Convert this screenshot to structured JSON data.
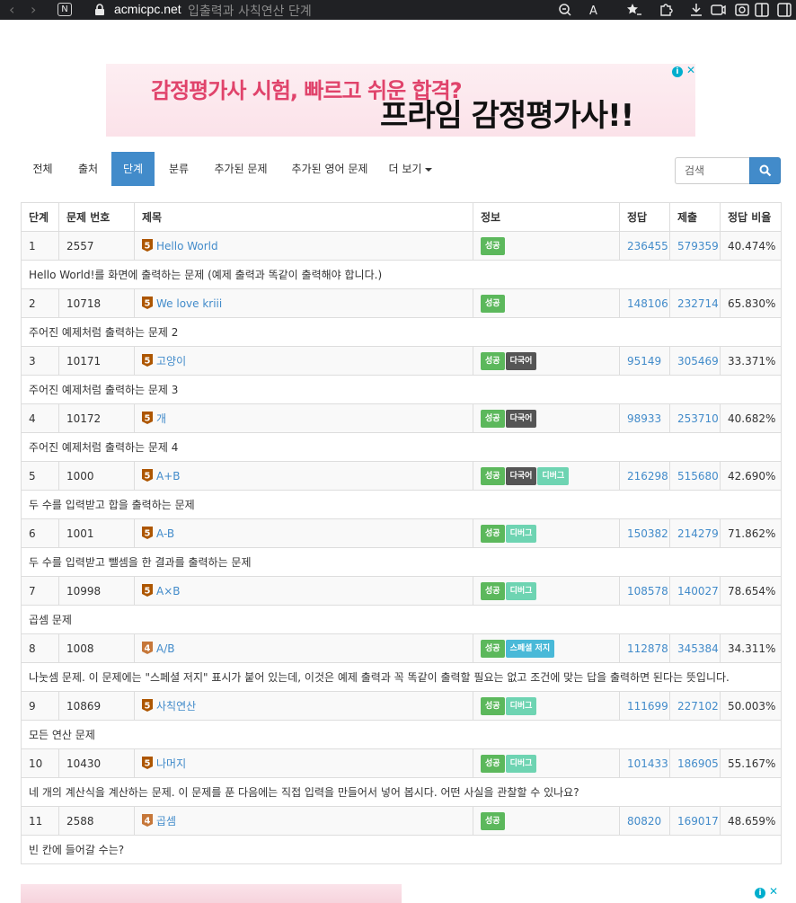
{
  "browser": {
    "url": "acmicpc.net",
    "page_title": "입출력과 사칙연산 단계"
  },
  "ad_top": {
    "line1": "감정평가사 시험, 빠르고 쉬운 합격?",
    "line2": "프라임 감정평가사!!"
  },
  "tabs": [
    {
      "label": "전체"
    },
    {
      "label": "출처"
    },
    {
      "label": "단계",
      "active": true
    },
    {
      "label": "분류"
    },
    {
      "label": "추가된 문제"
    },
    {
      "label": "추가된 영어 문제"
    },
    {
      "label": "더 보기"
    }
  ],
  "search": {
    "placeholder": "검색"
  },
  "table": {
    "headers": [
      "단계",
      "문제 번호",
      "제목",
      "정보",
      "정답",
      "제출",
      "정답 비율"
    ],
    "rows": [
      {
        "step": "1",
        "id": "2557",
        "tier": "5",
        "title": "Hello World",
        "labels": [
          "성공"
        ],
        "correct": "236455",
        "submit": "579359",
        "ratio": "40.474%",
        "desc": "Hello World!를 화면에 출력하는 문제 (예제 출력과 똑같이 출력해야 합니다.)"
      },
      {
        "step": "2",
        "id": "10718",
        "tier": "5",
        "title": "We love kriii",
        "labels": [
          "성공"
        ],
        "correct": "148106",
        "submit": "232714",
        "ratio": "65.830%",
        "desc": "주어진 예제처럼 출력하는 문제 2"
      },
      {
        "step": "3",
        "id": "10171",
        "tier": "5",
        "title": "고양이",
        "labels": [
          "성공",
          "다국어"
        ],
        "correct": "95149",
        "submit": "305469",
        "ratio": "33.371%",
        "desc": "주어진 예제처럼 출력하는 문제 3"
      },
      {
        "step": "4",
        "id": "10172",
        "tier": "5",
        "title": "개",
        "labels": [
          "성공",
          "다국어"
        ],
        "correct": "98933",
        "submit": "253710",
        "ratio": "40.682%",
        "desc": "주어진 예제처럼 출력하는 문제 4"
      },
      {
        "step": "5",
        "id": "1000",
        "tier": "5",
        "title": "A+B",
        "labels": [
          "성공",
          "다국어",
          "디버그"
        ],
        "correct": "216298",
        "submit": "515680",
        "ratio": "42.690%",
        "desc": "두 수를 입력받고 합을 출력하는 문제"
      },
      {
        "step": "6",
        "id": "1001",
        "tier": "5",
        "title": "A-B",
        "labels": [
          "성공",
          "디버그"
        ],
        "correct": "150382",
        "submit": "214279",
        "ratio": "71.862%",
        "desc": "두 수를 입력받고 뺄셈을 한 결과를 출력하는 문제"
      },
      {
        "step": "7",
        "id": "10998",
        "tier": "5",
        "title": "A×B",
        "labels": [
          "성공",
          "디버그"
        ],
        "correct": "108578",
        "submit": "140027",
        "ratio": "78.654%",
        "desc": "곱셈 문제"
      },
      {
        "step": "8",
        "id": "1008",
        "tier": "4",
        "title": "A/B",
        "labels": [
          "성공",
          "스페셜 저지"
        ],
        "correct": "112878",
        "submit": "345384",
        "ratio": "34.311%",
        "desc": "나눗셈 문제. 이 문제에는 \"스페셜 저지\" 표시가 붙어 있는데, 이것은 예제 출력과 꼭 똑같이 출력할 필요는 없고 조건에 맞는 답을 출력하면 된다는 뜻입니다."
      },
      {
        "step": "9",
        "id": "10869",
        "tier": "5",
        "title": "사칙연산",
        "labels": [
          "성공",
          "디버그"
        ],
        "correct": "111699",
        "submit": "227102",
        "ratio": "50.003%",
        "desc": "모든 연산 문제"
      },
      {
        "step": "10",
        "id": "10430",
        "tier": "5",
        "title": "나머지",
        "labels": [
          "성공",
          "디버그"
        ],
        "correct": "101433",
        "submit": "186905",
        "ratio": "55.167%",
        "desc": "네 개의 계산식을 계산하는 문제. 이 문제를 푼 다음에는 직접 입력을 만들어서 넣어 봅시다. 어떤 사실을 관찰할 수 있나요?"
      },
      {
        "step": "11",
        "id": "2588",
        "tier": "4",
        "title": "곱셈",
        "labels": [
          "성공"
        ],
        "correct": "80820",
        "submit": "169017",
        "ratio": "48.659%",
        "desc": "빈 칸에 들어갈 수는?"
      }
    ]
  },
  "colors": {
    "accent": "#428bca",
    "tier_bronze5": "#ad5600",
    "tier_bronze4": "#c67739",
    "label_success": "#5cb85c",
    "label_multi": "#555555",
    "label_debug": "#6ed4b2",
    "label_special": "#49b9d8"
  }
}
